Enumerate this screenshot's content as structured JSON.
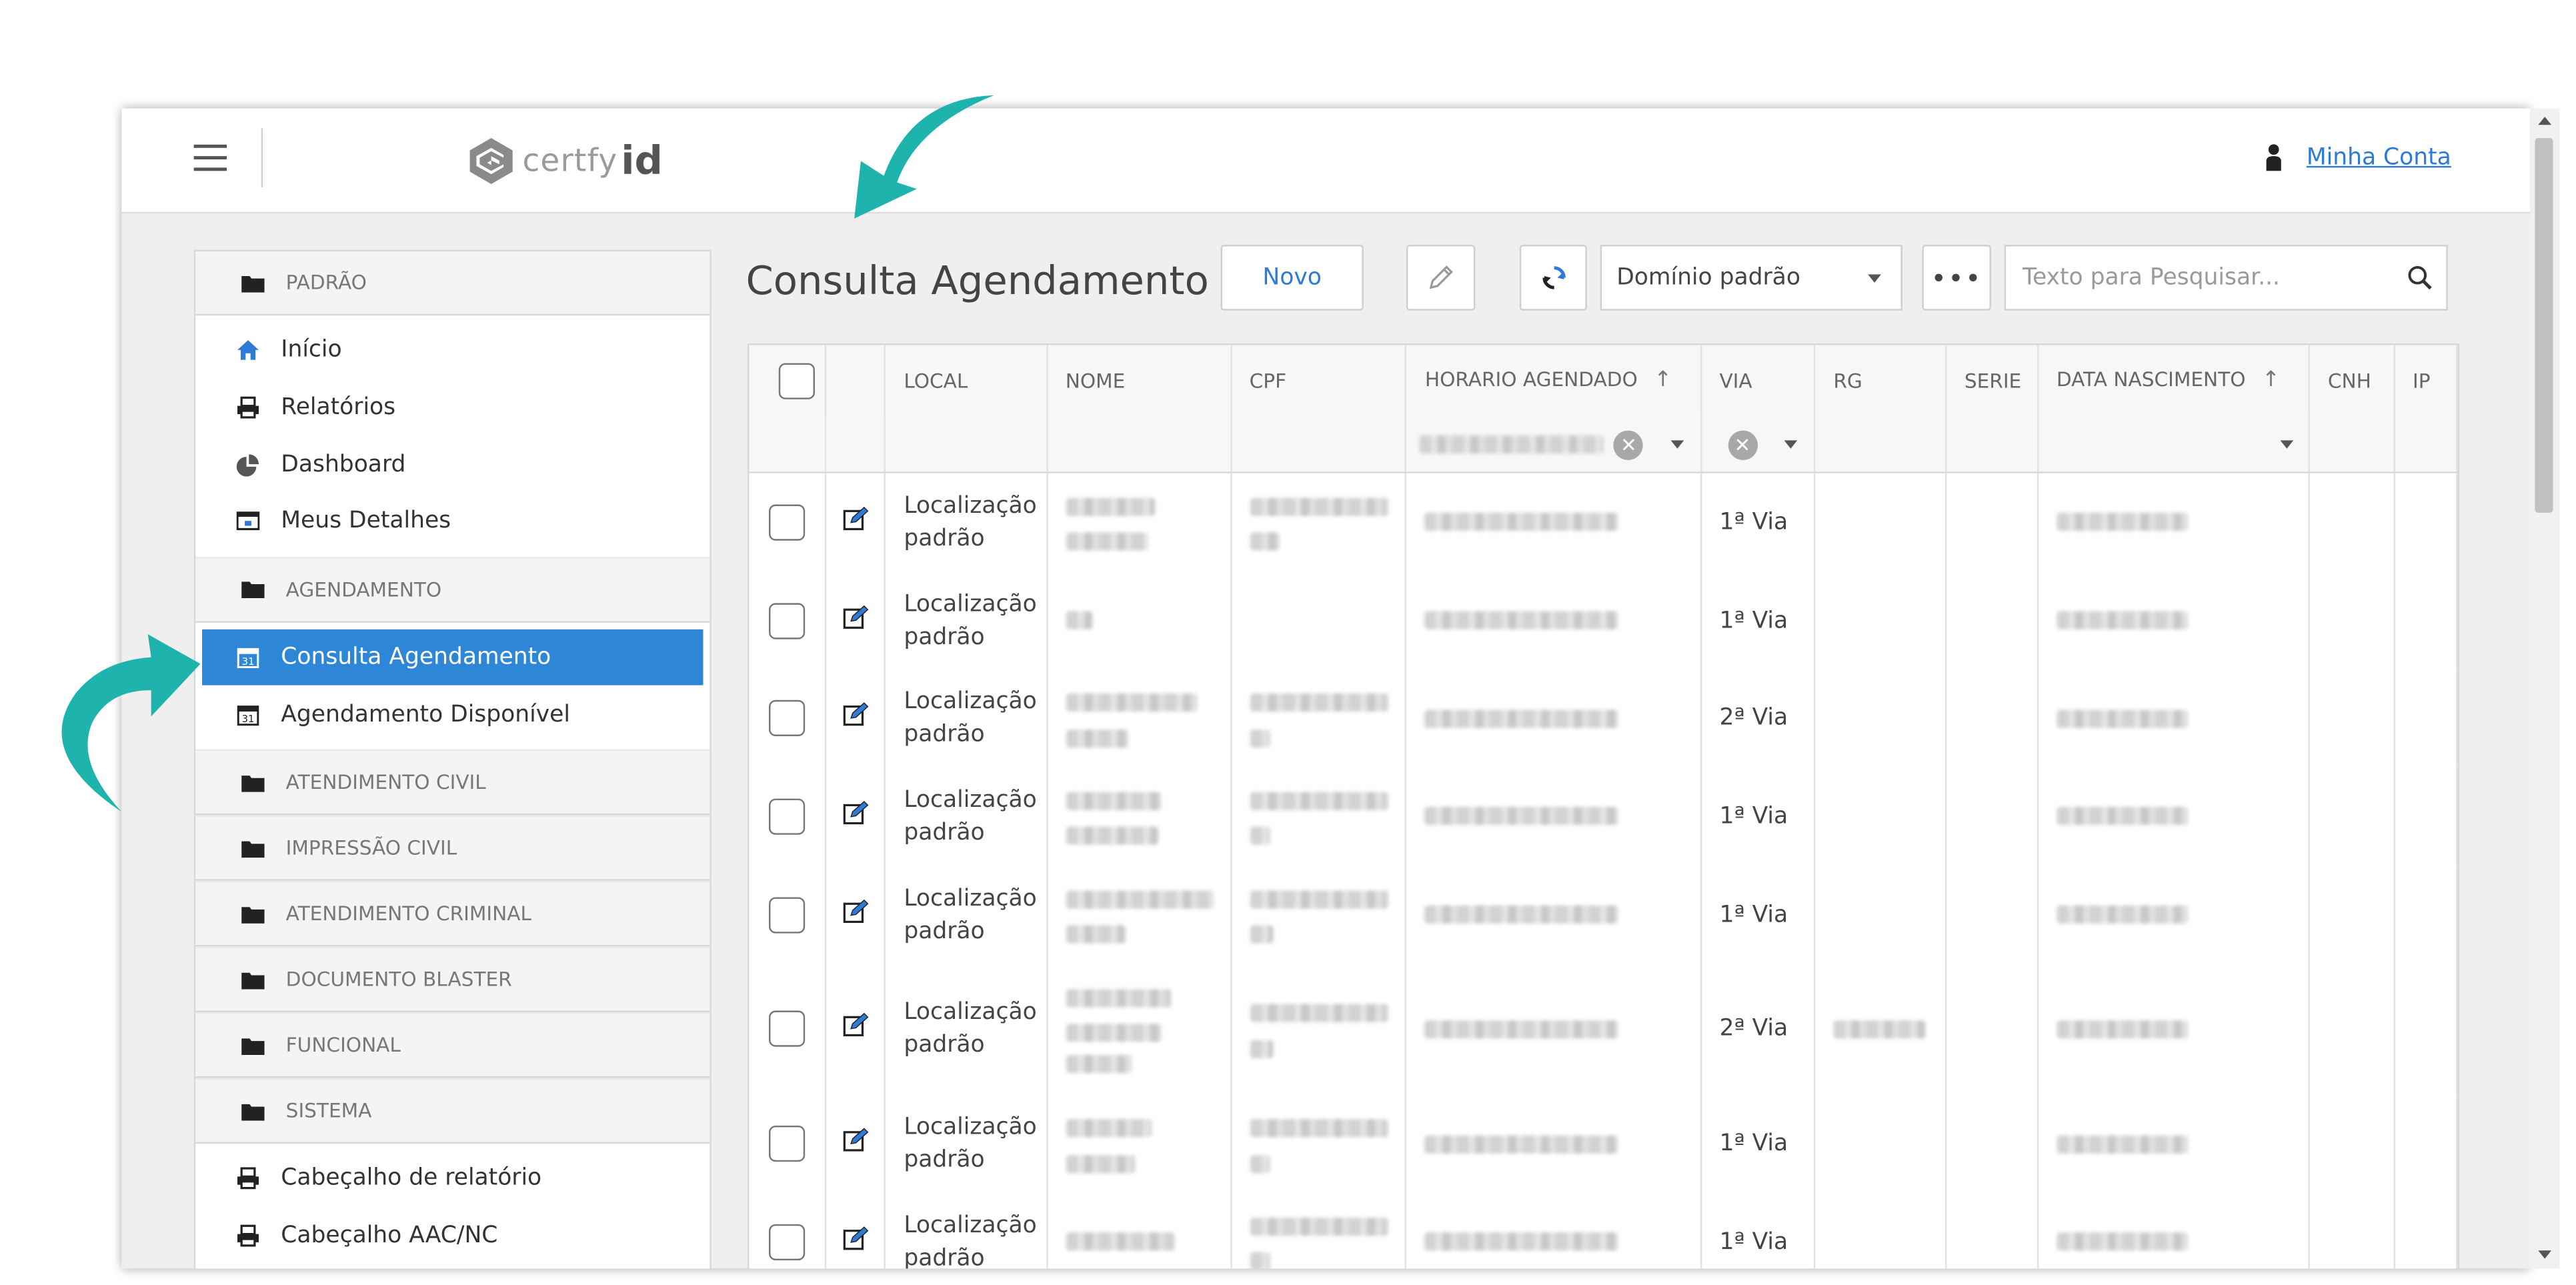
{
  "app": {
    "logo_text_light": "certfy",
    "logo_text_bold": "id",
    "account_link": "Minha Conta"
  },
  "sidebar": {
    "sections": [
      {
        "label": "PADRÃO",
        "items": [
          "Início",
          "Relatórios",
          "Dashboard",
          "Meus Detalhes"
        ]
      },
      {
        "label": "AGENDAMENTO",
        "items": [
          "Consulta Agendamento",
          "Agendamento Disponível"
        ]
      },
      {
        "label": "ATENDIMENTO CIVIL",
        "items": []
      },
      {
        "label": "IMPRESSÃO CIVIL",
        "items": []
      },
      {
        "label": "ATENDIMENTO CRIMINAL",
        "items": []
      },
      {
        "label": "DOCUMENTO BLASTER",
        "items": []
      },
      {
        "label": "FUNCIONAL",
        "items": []
      },
      {
        "label": "SISTEMA",
        "items": [
          "Cabeçalho de relatório",
          "Cabeçalho AAC/NC"
        ]
      }
    ],
    "active_item": "Consulta Agendamento"
  },
  "toolbar": {
    "page_title": "Consulta Agendamento",
    "new_button": "Novo",
    "domain_select": "Domínio padrão",
    "more_button": "•••",
    "search_placeholder": "Texto para Pesquisar..."
  },
  "table": {
    "columns": [
      "",
      "",
      "LOCAL",
      "NOME",
      "CPF",
      "HORARIO AGENDADO",
      "VIA",
      "RG",
      "SERIE",
      "DATA NASCIMENTO",
      "CNH",
      "IP"
    ],
    "sort_icon": "↑",
    "rows": [
      {
        "local": "Localização padrão",
        "via": "1ª Via"
      },
      {
        "local": "Localização padrão",
        "via": "1ª Via"
      },
      {
        "local": "Localização padrão",
        "via": "2ª Via"
      },
      {
        "local": "Localização padrão",
        "via": "1ª Via"
      },
      {
        "local": "Localização padrão",
        "via": "1ª Via"
      },
      {
        "local": "Localização padrão",
        "via": "2ª Via"
      },
      {
        "local": "Localização padrão",
        "via": "1ª Via"
      },
      {
        "local": "Localização padrão",
        "via": "1ª Via"
      }
    ]
  },
  "colors": {
    "accent": "#2d87d6",
    "link": "#2d7bd6",
    "annotation_arrow": "#1fb3ad"
  }
}
